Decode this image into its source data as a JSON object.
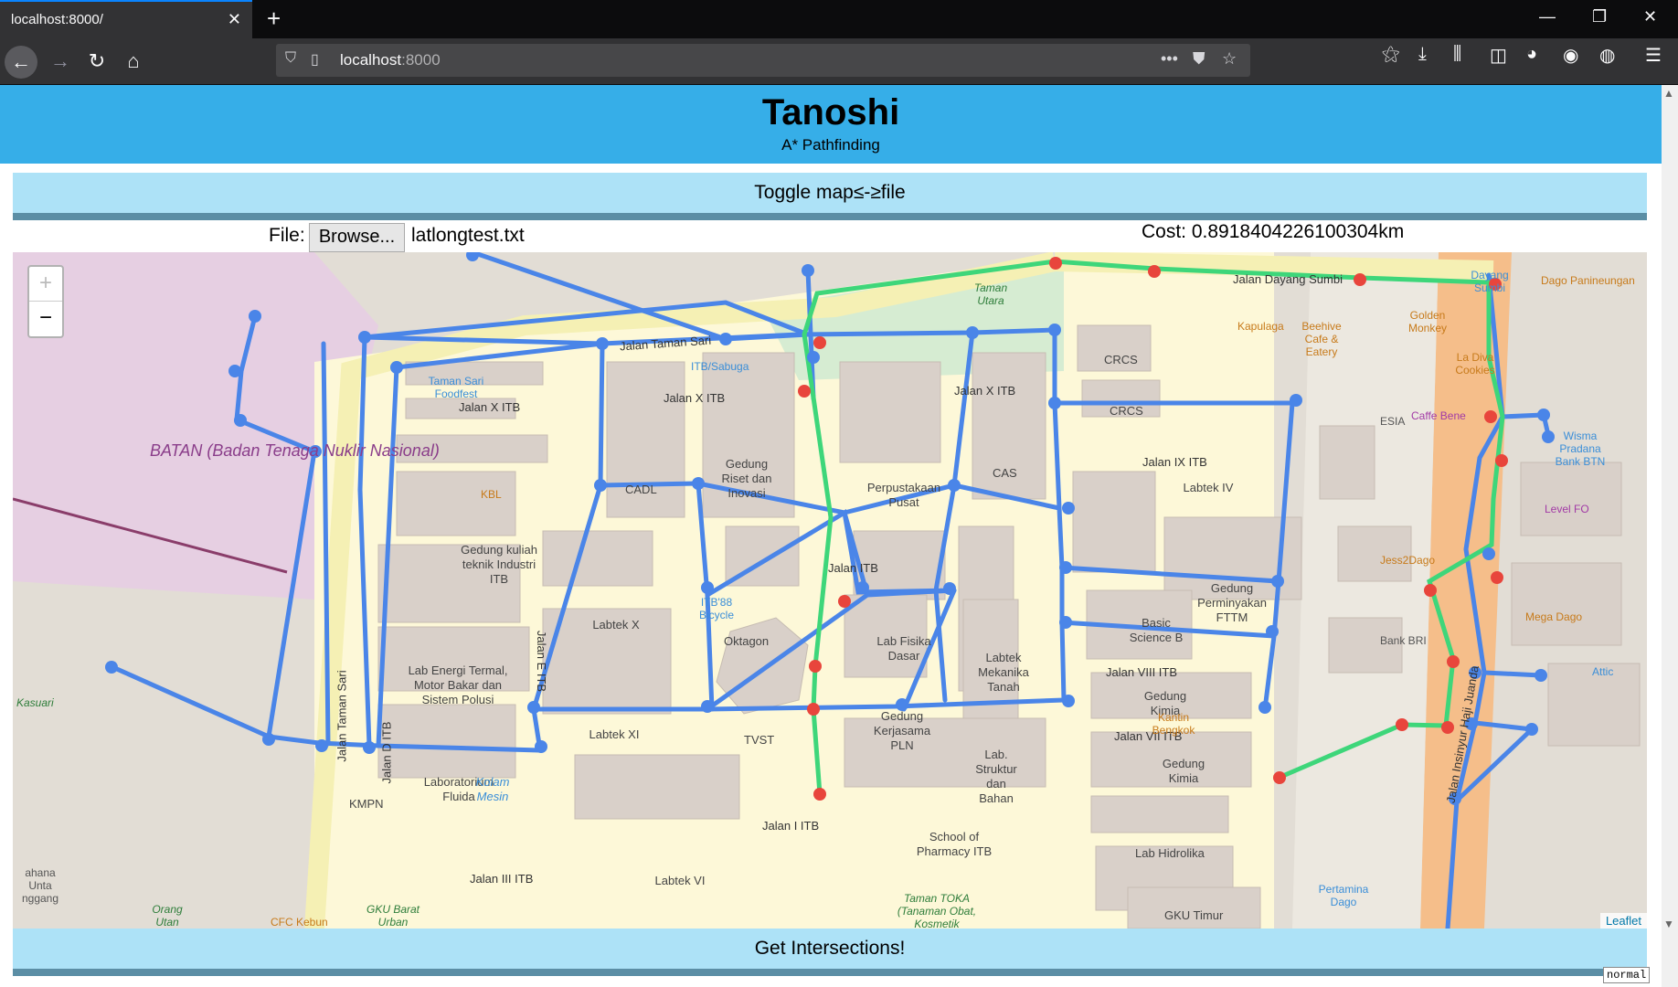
{
  "browser": {
    "tab_title": "localhost:8000/",
    "tab_close": "✕",
    "new_tab": "+",
    "window_controls": {
      "minimize": "—",
      "restore": "❐",
      "close": "✕"
    },
    "url_host": "localhost",
    "url_port": ":8000",
    "url_more": "•••",
    "nav": {
      "back": "←",
      "forward": "→",
      "reload": "↻",
      "home": "⌂"
    },
    "toolbar_icons": [
      "pocket-icon",
      "bookmark-star-icon",
      "reading-list-icon",
      "downloads-icon",
      "library-icon",
      "sidebar-icon",
      "avatar-icon",
      "extension-icon",
      "sync-icon",
      "menu-icon"
    ]
  },
  "header": {
    "title": "Tanoshi",
    "subtitle": "A* Pathfinding"
  },
  "controls": {
    "toggle_label": "Toggle map≤-≥file",
    "file_label": "File:",
    "browse_label": "Browse...",
    "file_name": "latlongtest.txt",
    "cost_text": "Cost: 0.8918404226100304km",
    "intersections_label": "Get Intersections!"
  },
  "map": {
    "zoom_in": "+",
    "zoom_out": "−",
    "attribution": "Leaflet",
    "streets": [
      "Jalan Taman Sari",
      "Jalan X ITB",
      "Jalan X ITB",
      "Jalan X ITB",
      "Jalan Dayang Sumbi",
      "Jalan IX ITB",
      "Jalan VIII ITB",
      "Jalan VII ITB",
      "Jalan E ITB",
      "Jalan D ITB",
      "Jalan III ITB",
      "Jalan I ITB",
      "Jalan Taman Sari",
      "Jalan Insinyur Haji Juanda",
      "Jalan ITB"
    ],
    "buildings": [
      "CRCS",
      "CRCS",
      "CAS",
      "CADL",
      "Gedung Riset dan Inovasi",
      "Perpustakaan Pusat",
      "Labtek IV",
      "Gedung kuliah teknik Industri ITB",
      "Labtek X",
      "Oktagon",
      "Lab Fisika Dasar",
      "Labtek Mekanika Tanah",
      "Basic Science B",
      "Gedung Perminyakan FTTM",
      "Gedung Kimia",
      "Lab Energi Termal, Motor Bakar dan Sistem Polusi",
      "Labtek XI",
      "TVST",
      "Gedung Kerjasama PLN",
      "Lab. Struktur dan Bahan",
      "Gedung Kimia",
      "Laboratorium Fluida",
      "Kolam Mesin",
      "Labtek VI",
      "School of Pharmacy ITB",
      "Lab Hidrolika",
      "GKU Timur",
      "KMPN"
    ],
    "pois": [
      "KBL",
      "Taman Sari Foodfest",
      "ITB/Sabuga",
      "Taman Utara",
      "ITB'88 Bicycle",
      "Kapulaga",
      "Beehive Cafe & Eatery",
      "Golden Monkey",
      "La Diva Cookies",
      "ESIA",
      "Caffe Bene",
      "Dayang Sumbi",
      "Dago Panineungan",
      "Wisma Pradana Bank BTN",
      "Level FO",
      "Jess2Dago",
      "Mega Dago",
      "Bank BRI",
      "Attic",
      "Kantin Bengkok",
      "Pertamina Dago",
      "Taman TOKA (Tanaman Obat, Kosmetik",
      "GKU Barat Urban",
      "CFC Kebun",
      "Orang Utan",
      "Kasuari",
      "ahana Unta nggang"
    ],
    "batan_label": "BATAN (Badan Tenaga Nuklir Nasional)",
    "colors": {
      "graph_edge": "#4a85e8",
      "path": "#3ed67a",
      "path_node": "#e8453c",
      "node": "#4a85e8"
    }
  },
  "footer": {
    "mode_badge": "normal"
  }
}
